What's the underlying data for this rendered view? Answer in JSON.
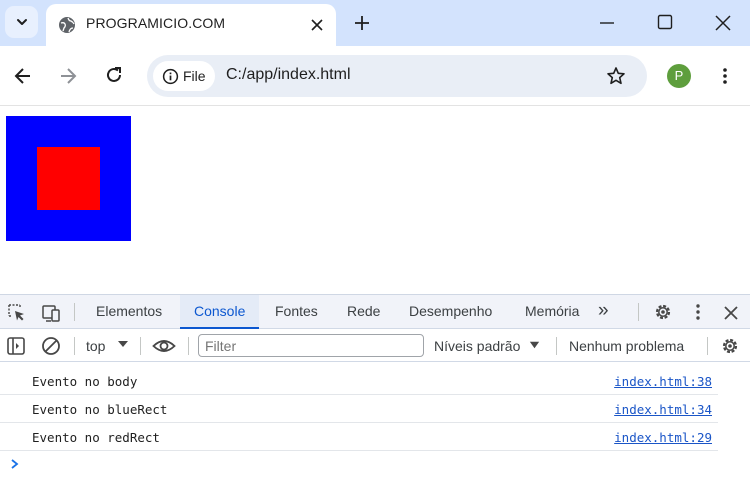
{
  "browser": {
    "tab_title": "PROGRAMICIO.COM",
    "site_chip_label": "File",
    "url": "C:/app/index.html",
    "profile_initial": "P",
    "icons": [
      "tab-search-icon",
      "globe-icon",
      "close-icon",
      "plus-icon",
      "minimize-icon",
      "maximize-icon",
      "window-close-icon",
      "back-arrow-icon",
      "forward-arrow-icon",
      "reload-icon",
      "info-icon",
      "star-icon",
      "kebab-menu-icon"
    ]
  },
  "page": {
    "outer_color": "#0000ff",
    "inner_color": "#ff0000"
  },
  "devtools": {
    "tabs": [
      "Elementos",
      "Console",
      "Fontes",
      "Rede",
      "Desempenho",
      "Memória"
    ],
    "active_tab": "Console",
    "more_tabs": "»",
    "context": "top",
    "filter_placeholder": "Filter",
    "levels": "Níveis padrão",
    "issues": "Nenhum problema",
    "logs": [
      {
        "message": "Evento no body",
        "source": "index.html:38"
      },
      {
        "message": "Evento no blueRect",
        "source": "index.html:34"
      },
      {
        "message": "Evento no redRect",
        "source": "index.html:29"
      }
    ],
    "accent_color": "#0b57d0"
  }
}
